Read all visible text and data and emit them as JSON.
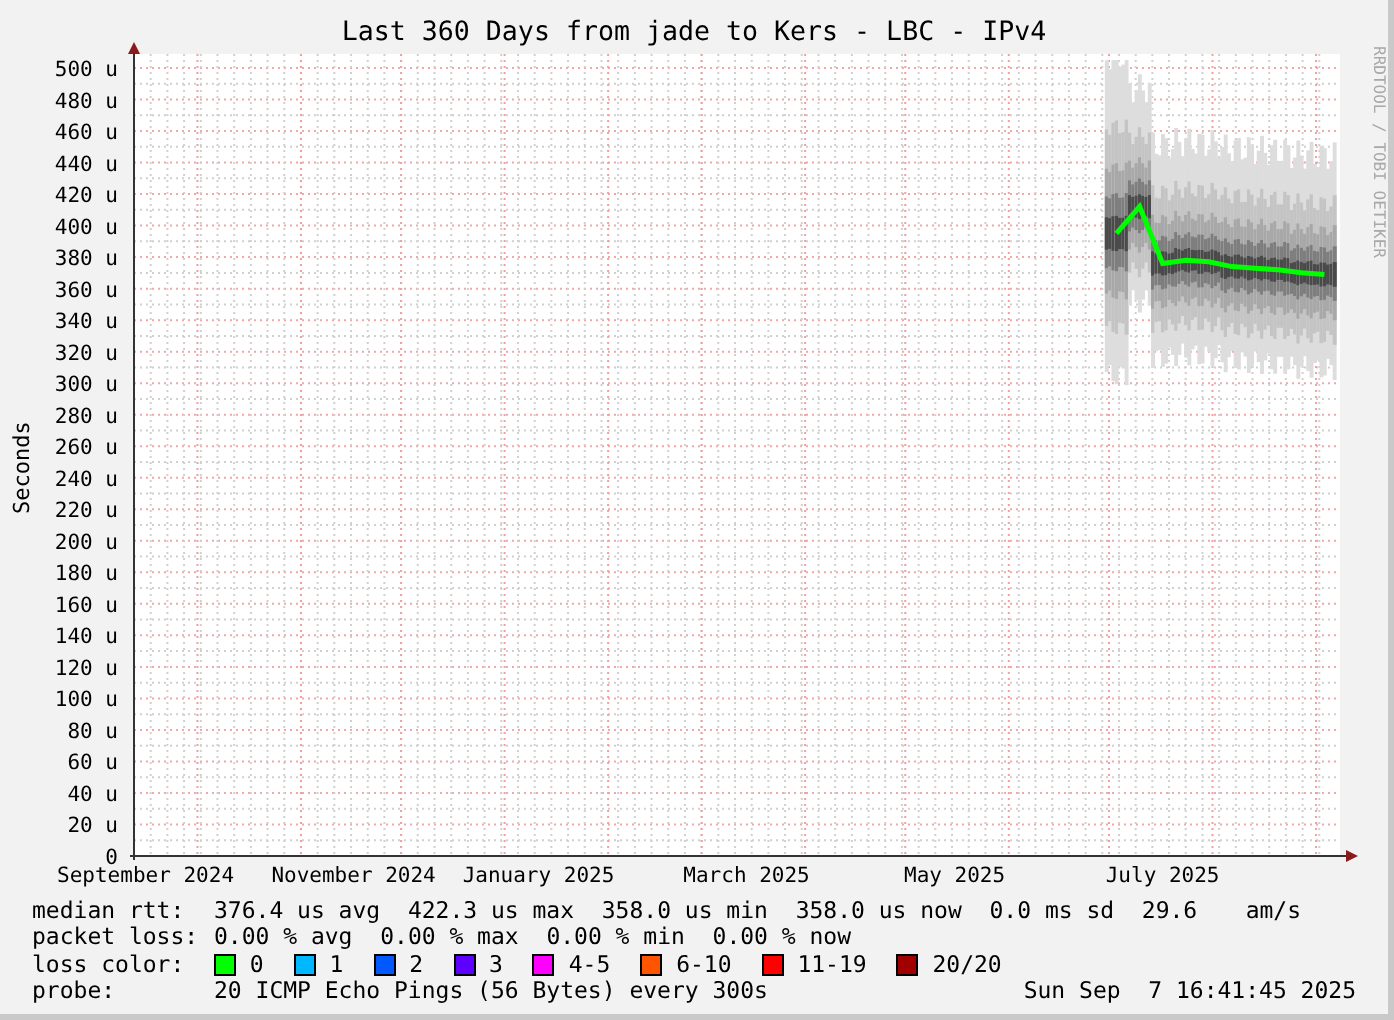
{
  "side_label": "RRDTOOL / TOBI OETIKER",
  "chart_data": {
    "type": "line",
    "title": "Last 360 Days from jade to Kers - LBC - IPv4",
    "ylabel": "Seconds",
    "categories": [
      "September 2024",
      null,
      null,
      null,
      null,
      null,
      null,
      null,
      null,
      "November 2024",
      null,
      null,
      null,
      null,
      null,
      null,
      null,
      "January 2025",
      null,
      null,
      null,
      null,
      null,
      null,
      null,
      null,
      "March 2025",
      null,
      null,
      null,
      null,
      null,
      null,
      null,
      null,
      "May 2025",
      null,
      null,
      null,
      null,
      null,
      null,
      null,
      null,
      "July 2025",
      null,
      null,
      null,
      null,
      null,
      null,
      null
    ],
    "series": [
      {
        "name": "median rtt:",
        "color": "#00ff00",
        "values": [
          null,
          null,
          null,
          null,
          null,
          null,
          null,
          null,
          null,
          null,
          null,
          null,
          null,
          null,
          null,
          null,
          null,
          null,
          null,
          null,
          null,
          null,
          null,
          null,
          null,
          null,
          null,
          null,
          null,
          null,
          null,
          null,
          null,
          null,
          null,
          null,
          null,
          null,
          null,
          null,
          null,
          null,
          395,
          412,
          376,
          378,
          377,
          374,
          373,
          372,
          370,
          369
        ]
      }
    ],
    "ylim": [
      0,
      500
    ],
    "grid": true,
    "yticks": [
      {
        "value": 0,
        "label": "0"
      },
      {
        "value": 20,
        "label": "20 u"
      },
      {
        "value": 40,
        "label": "40 u"
      },
      {
        "value": 60,
        "label": "60 u"
      },
      {
        "value": 80,
        "label": "80 u"
      },
      {
        "value": 100,
        "label": "100 u"
      },
      {
        "value": 120,
        "label": "120 u"
      },
      {
        "value": 140,
        "label": "140 u"
      },
      {
        "value": 160,
        "label": "160 u"
      },
      {
        "value": 180,
        "label": "180 u"
      },
      {
        "value": 200,
        "label": "200 u"
      },
      {
        "value": 220,
        "label": "220 u"
      },
      {
        "value": 240,
        "label": "240 u"
      },
      {
        "value": 260,
        "label": "260 u"
      },
      {
        "value": 280,
        "label": "280 u"
      },
      {
        "value": 300,
        "label": "300 u"
      },
      {
        "value": 320,
        "label": "320 u"
      },
      {
        "value": 340,
        "label": "340 u"
      },
      {
        "value": 360,
        "label": "360 u"
      },
      {
        "value": 380,
        "label": "380 u"
      },
      {
        "value": 400,
        "label": "400 u"
      },
      {
        "value": 420,
        "label": "420 u"
      },
      {
        "value": 440,
        "label": "440 u"
      },
      {
        "value": 460,
        "label": "460 u"
      },
      {
        "value": 480,
        "label": "480 u"
      },
      {
        "value": 500,
        "label": "500 u"
      }
    ]
  },
  "median_rtt": {
    "values": [
      "376.4 us avg",
      "422.3 us max",
      "358.0 us min",
      "358.0 us now",
      "0.0 ms sd",
      "29.6",
      "am/s"
    ]
  },
  "packet_loss": {
    "label": "packet loss:",
    "values": [
      "0.00 % avg",
      "0.00 % max",
      "0.00 % min",
      "0.00 % now"
    ]
  },
  "loss_color": {
    "label": "loss color:",
    "items": [
      {
        "label": "0",
        "color": "#00ff00"
      },
      {
        "label": "1",
        "color": "#00b8ff"
      },
      {
        "label": "2",
        "color": "#0059ff"
      },
      {
        "label": "3",
        "color": "#5e00ff"
      },
      {
        "label": "4-5",
        "color": "#ff00ff"
      },
      {
        "label": "6-10",
        "color": "#ff5500"
      },
      {
        "label": "11-19",
        "color": "#ff0000"
      },
      {
        "label": "20/20",
        "color": "#a10000"
      }
    ]
  },
  "probe": {
    "label": "probe:",
    "text": "20 ICMP Echo Pings (56 Bytes) every 300s",
    "timestamp": "Sun Sep  7 16:41:45 2025"
  }
}
